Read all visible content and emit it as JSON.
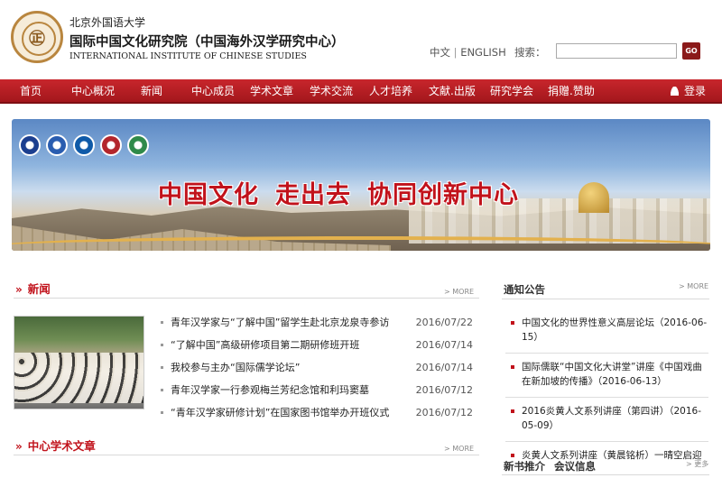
{
  "header": {
    "logo_glyph": "㊣",
    "university": "北京外国语大学",
    "institute_cn": "国际中国文化研究院（中国海外汉学研究中心）",
    "institute_en": "INTERNATIONAL INSTITUTE OF CHINESE STUDIES",
    "lang_cn": "中文",
    "lang_sep": "|",
    "lang_en": "ENGLISH",
    "search_label": "搜索：",
    "search_value": "",
    "search_button": "GO"
  },
  "nav": {
    "items": [
      "首页",
      "中心概况",
      "新闻",
      "中心成员",
      "学术文章",
      "学术交流",
      "人才培养",
      "文献.出版",
      "研究学会",
      "捐赠.赞助"
    ],
    "login": "登录"
  },
  "banner": {
    "slogan_1": "中国文化",
    "slogan_2": "走出去",
    "slogan_3": "协同创新中心",
    "emblem_colors": [
      "#1c3f8f",
      "#2a5db0",
      "#0f5aa8",
      "#b3262c",
      "#2f8a4a"
    ]
  },
  "news": {
    "title": "新闻",
    "more": "> MORE",
    "items": [
      {
        "title": "青年汉学家与“了解中国”留学生赴北京龙泉寺参访",
        "date": "2016/07/22"
      },
      {
        "title": "“了解中国”高级研修项目第二期研修班开班",
        "date": "2016/07/14"
      },
      {
        "title": "我校参与主办“国际儒学论坛”",
        "date": "2016/07/14"
      },
      {
        "title": "青年汉学家一行参观梅兰芳纪念馆和利玛窦墓",
        "date": "2016/07/12"
      },
      {
        "title": "“青年汉学家研修计划”在国家图书馆举办开班仪式",
        "date": "2016/07/12"
      }
    ]
  },
  "articles": {
    "title": "中心学术文章",
    "more": "> MORE"
  },
  "notices": {
    "title": "通知公告",
    "more": "> MORE",
    "items": [
      "中国文化的世界性意义高层论坛（2016-06-15）",
      "国际儒联“中国文化大讲堂”讲座《中国戏曲在新加坡的传播》（2016-06-13）",
      "2016炎黄人文系列讲座（第四讲）（2016-05-09）",
      "炎黄人文系列讲座（黄晨铭析）一晴空启迎"
    ]
  },
  "books": {
    "title": "新书推介",
    "title2": "会议信息",
    "more": "> 更多"
  },
  "colors": {
    "brand_red": "#c1121b",
    "nav_red": "#b31d22"
  }
}
